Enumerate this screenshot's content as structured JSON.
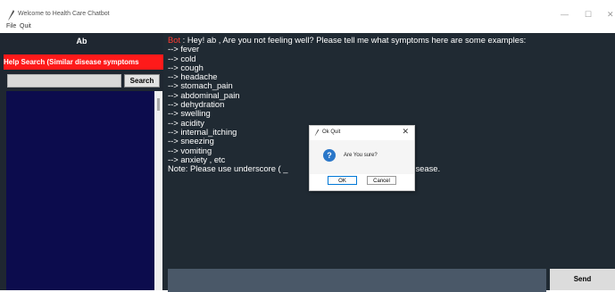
{
  "window": {
    "title": "Welcome to Health Care Chatbot",
    "min_glyph": "—",
    "max_glyph": "☐",
    "close_glyph": "✕"
  },
  "menu": {
    "file": "File",
    "quit": "Quit"
  },
  "sidebar": {
    "username": "Ab",
    "help_label": "Help Search (Similar disease symptoms",
    "search_value": "",
    "search_button": "Search"
  },
  "chat": {
    "bot_prefix": "Bot",
    "first_line_rest": " : Hey! ab , Are you not feeling well? Please tell me what symptoms here are some examples:",
    "symptoms": [
      "--> fever",
      "--> cold",
      "--> cough",
      "--> headache",
      "--> stomach_pain",
      "--> abdominal_pain",
      "--> dehydration",
      "--> swelling",
      "--> acidity",
      "--> internal_itching",
      "--> sneezing",
      "--> vomiting",
      "--> anxiety , etc"
    ],
    "note_part1": "Note: Please use underscore ( _ ",
    "note_part2": "the name of disease."
  },
  "input": {
    "message_value": "",
    "send_label": "Send"
  },
  "dialog": {
    "title": "Ok Quit",
    "message": "Are You sure?",
    "ok_label": "OK",
    "cancel_label": "Cancel",
    "close_glyph": "✕",
    "question_glyph": "?"
  },
  "colors": {
    "app_bg": "#202a33",
    "help_bar": "#ff1a1a",
    "listbox": "#0c0c4d",
    "bot_label": "#ff3b30",
    "entry_bg": "#4a5868"
  }
}
